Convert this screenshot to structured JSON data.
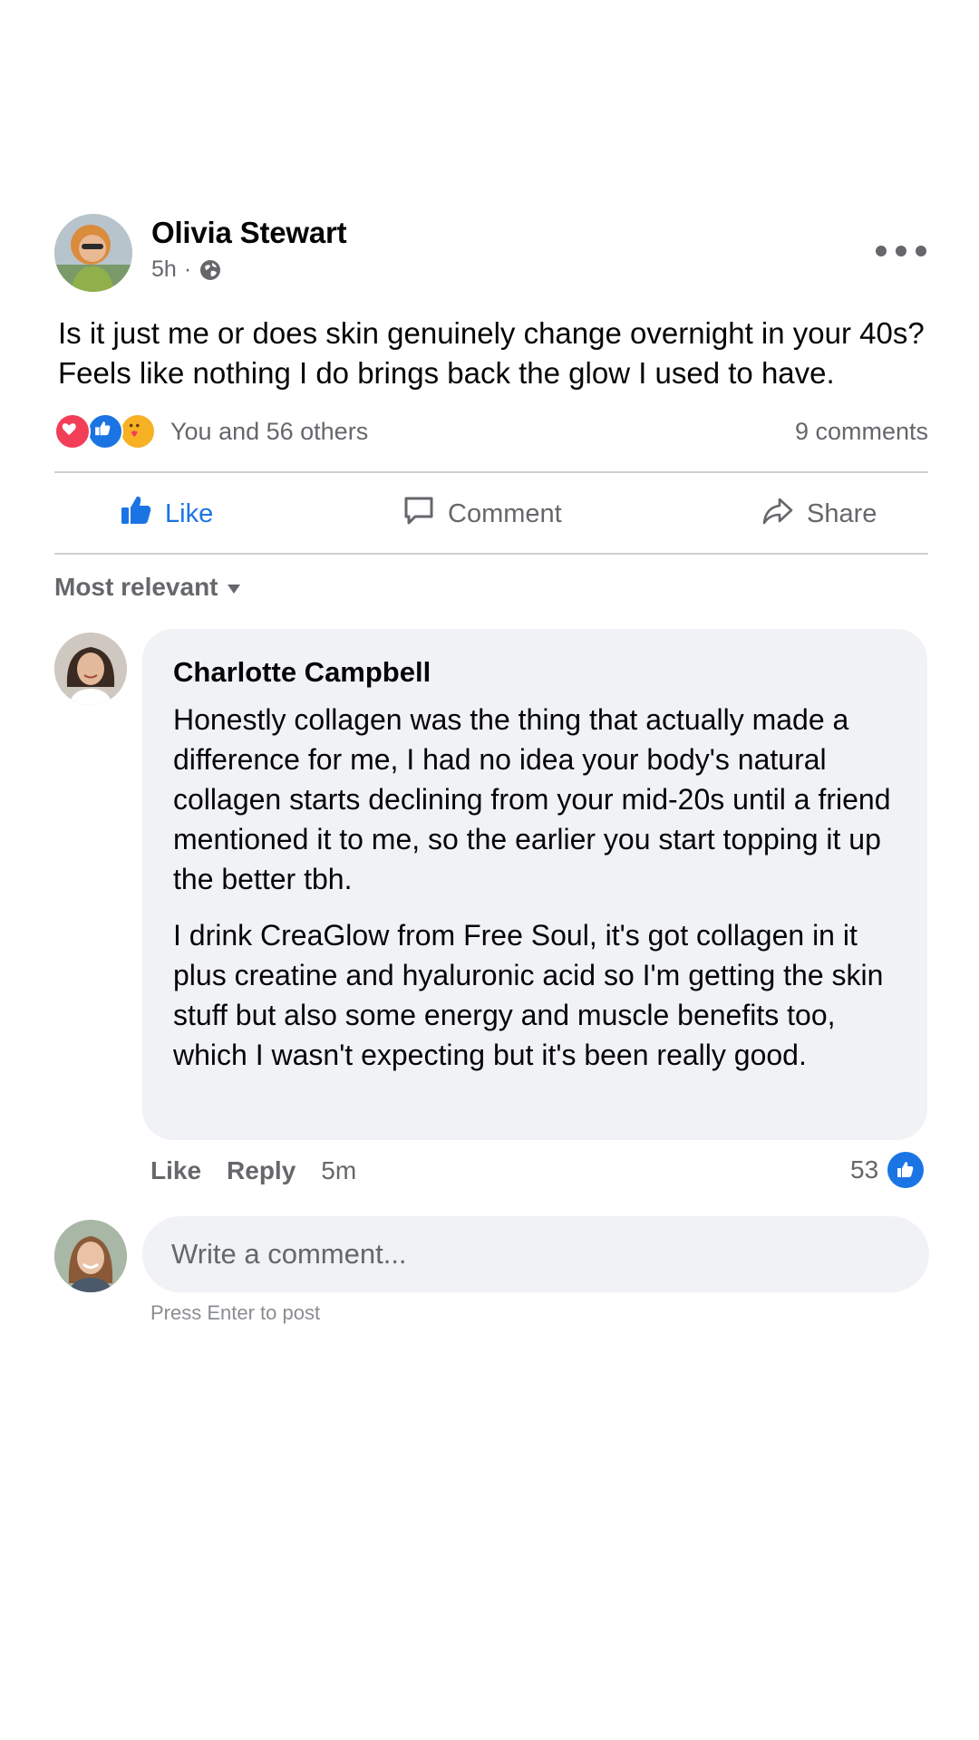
{
  "post": {
    "author": "Olivia Stewart",
    "time": "5h",
    "separator": "·",
    "text": "Is it just me or does skin genuinely change overnight in your 40s? Feels like nothing I do brings back the glow I used to have.",
    "reaction_summary": "You and 56 others",
    "comment_count": "9 comments",
    "reactions": [
      "heart-icon",
      "like-icon",
      "care-icon"
    ]
  },
  "actions": {
    "like": "Like",
    "comment": "Comment",
    "share": "Share",
    "like_color": "#1b74e4"
  },
  "comments": {
    "sort_label": "Most relevant",
    "top": {
      "author": "Charlotte Campbell",
      "paragraph_1": "Honestly collagen was the thing that actually made a difference for me, I had no idea your body's natural collagen starts declining from your mid-20s until a friend mentioned it to me, so the earlier you start topping it up the better tbh.",
      "paragraph_2": "I drink CreaGlow from Free Soul, it's got collagen in it plus creatine and hyaluronic acid so I'm getting the skin stuff but also some energy and muscle benefits too, which I wasn't expecting but it's been really good.",
      "like_label": "Like",
      "reply_label": "Reply",
      "time": "5m",
      "like_count": "53"
    }
  },
  "composer": {
    "placeholder": "Write a comment...",
    "hint": "Press Enter to post"
  }
}
